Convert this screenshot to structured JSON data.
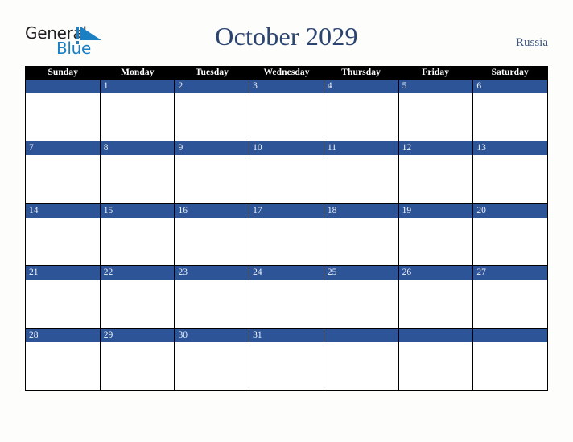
{
  "brand": {
    "name_part1": "General",
    "name_part2": "Blue",
    "mark_icon": "triangle-play-icon",
    "colors": {
      "dark": "#231f20",
      "blue": "#1b7fc4"
    }
  },
  "header": {
    "title": "October 2029",
    "country": "Russia",
    "title_color": "#2b4570"
  },
  "calendar": {
    "month": "October",
    "year": "2029",
    "weekday_headers": [
      "Sunday",
      "Monday",
      "Tuesday",
      "Wednesday",
      "Thursday",
      "Friday",
      "Saturday"
    ],
    "header_background": "#000000",
    "header_text_color": "#ffffff",
    "date_band_color": "#2d5496",
    "date_text_color": "#eef2f8",
    "cell_background": "#ffffff",
    "grid_line_color": "#000000",
    "weeks": [
      {
        "days": [
          {
            "number": ""
          },
          {
            "number": "1"
          },
          {
            "number": "2"
          },
          {
            "number": "3"
          },
          {
            "number": "4"
          },
          {
            "number": "5"
          },
          {
            "number": "6"
          }
        ]
      },
      {
        "days": [
          {
            "number": "7"
          },
          {
            "number": "8"
          },
          {
            "number": "9"
          },
          {
            "number": "10"
          },
          {
            "number": "11"
          },
          {
            "number": "12"
          },
          {
            "number": "13"
          }
        ]
      },
      {
        "days": [
          {
            "number": "14"
          },
          {
            "number": "15"
          },
          {
            "number": "16"
          },
          {
            "number": "17"
          },
          {
            "number": "18"
          },
          {
            "number": "19"
          },
          {
            "number": "20"
          }
        ]
      },
      {
        "days": [
          {
            "number": "21"
          },
          {
            "number": "22"
          },
          {
            "number": "23"
          },
          {
            "number": "24"
          },
          {
            "number": "25"
          },
          {
            "number": "26"
          },
          {
            "number": "27"
          }
        ]
      },
      {
        "days": [
          {
            "number": "28"
          },
          {
            "number": "29"
          },
          {
            "number": "30"
          },
          {
            "number": "31"
          },
          {
            "number": ""
          },
          {
            "number": ""
          },
          {
            "number": ""
          }
        ]
      }
    ]
  }
}
